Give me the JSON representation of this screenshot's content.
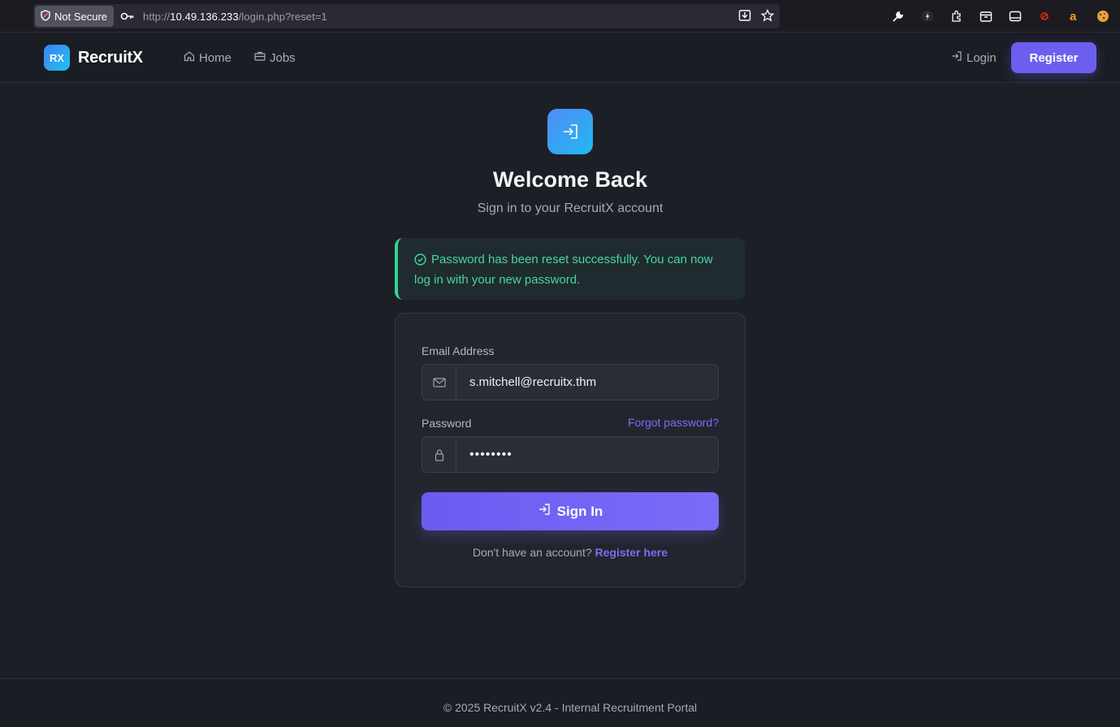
{
  "browser": {
    "security_label": "Not Secure",
    "url_prefix": "http://",
    "url_host": "10.49.136.233",
    "url_path": "/login.php?reset=1"
  },
  "nav": {
    "logo_mark": "RX",
    "brand": "RecruitX",
    "home": "Home",
    "jobs": "Jobs",
    "login": "Login",
    "register": "Register"
  },
  "page": {
    "title": "Welcome Back",
    "subtitle": "Sign in to your RecruitX account"
  },
  "alert": {
    "message": "Password has been reset successfully. You can now log in with your new password."
  },
  "form": {
    "email_label": "Email Address",
    "email_value": "s.mitchell@recruitx.thm",
    "password_label": "Password",
    "forgot_link": "Forgot password?",
    "password_mask": "••••••••",
    "submit": "Sign In",
    "no_account_text": "Don't have an account?",
    "register_link": "Register here"
  },
  "footer": {
    "text": "© 2025 RecruitX v2.4 - Internal Recruitment Portal"
  },
  "colors": {
    "accent": "#6c5ff0",
    "success": "#34d399",
    "background": "#1c1f26"
  }
}
